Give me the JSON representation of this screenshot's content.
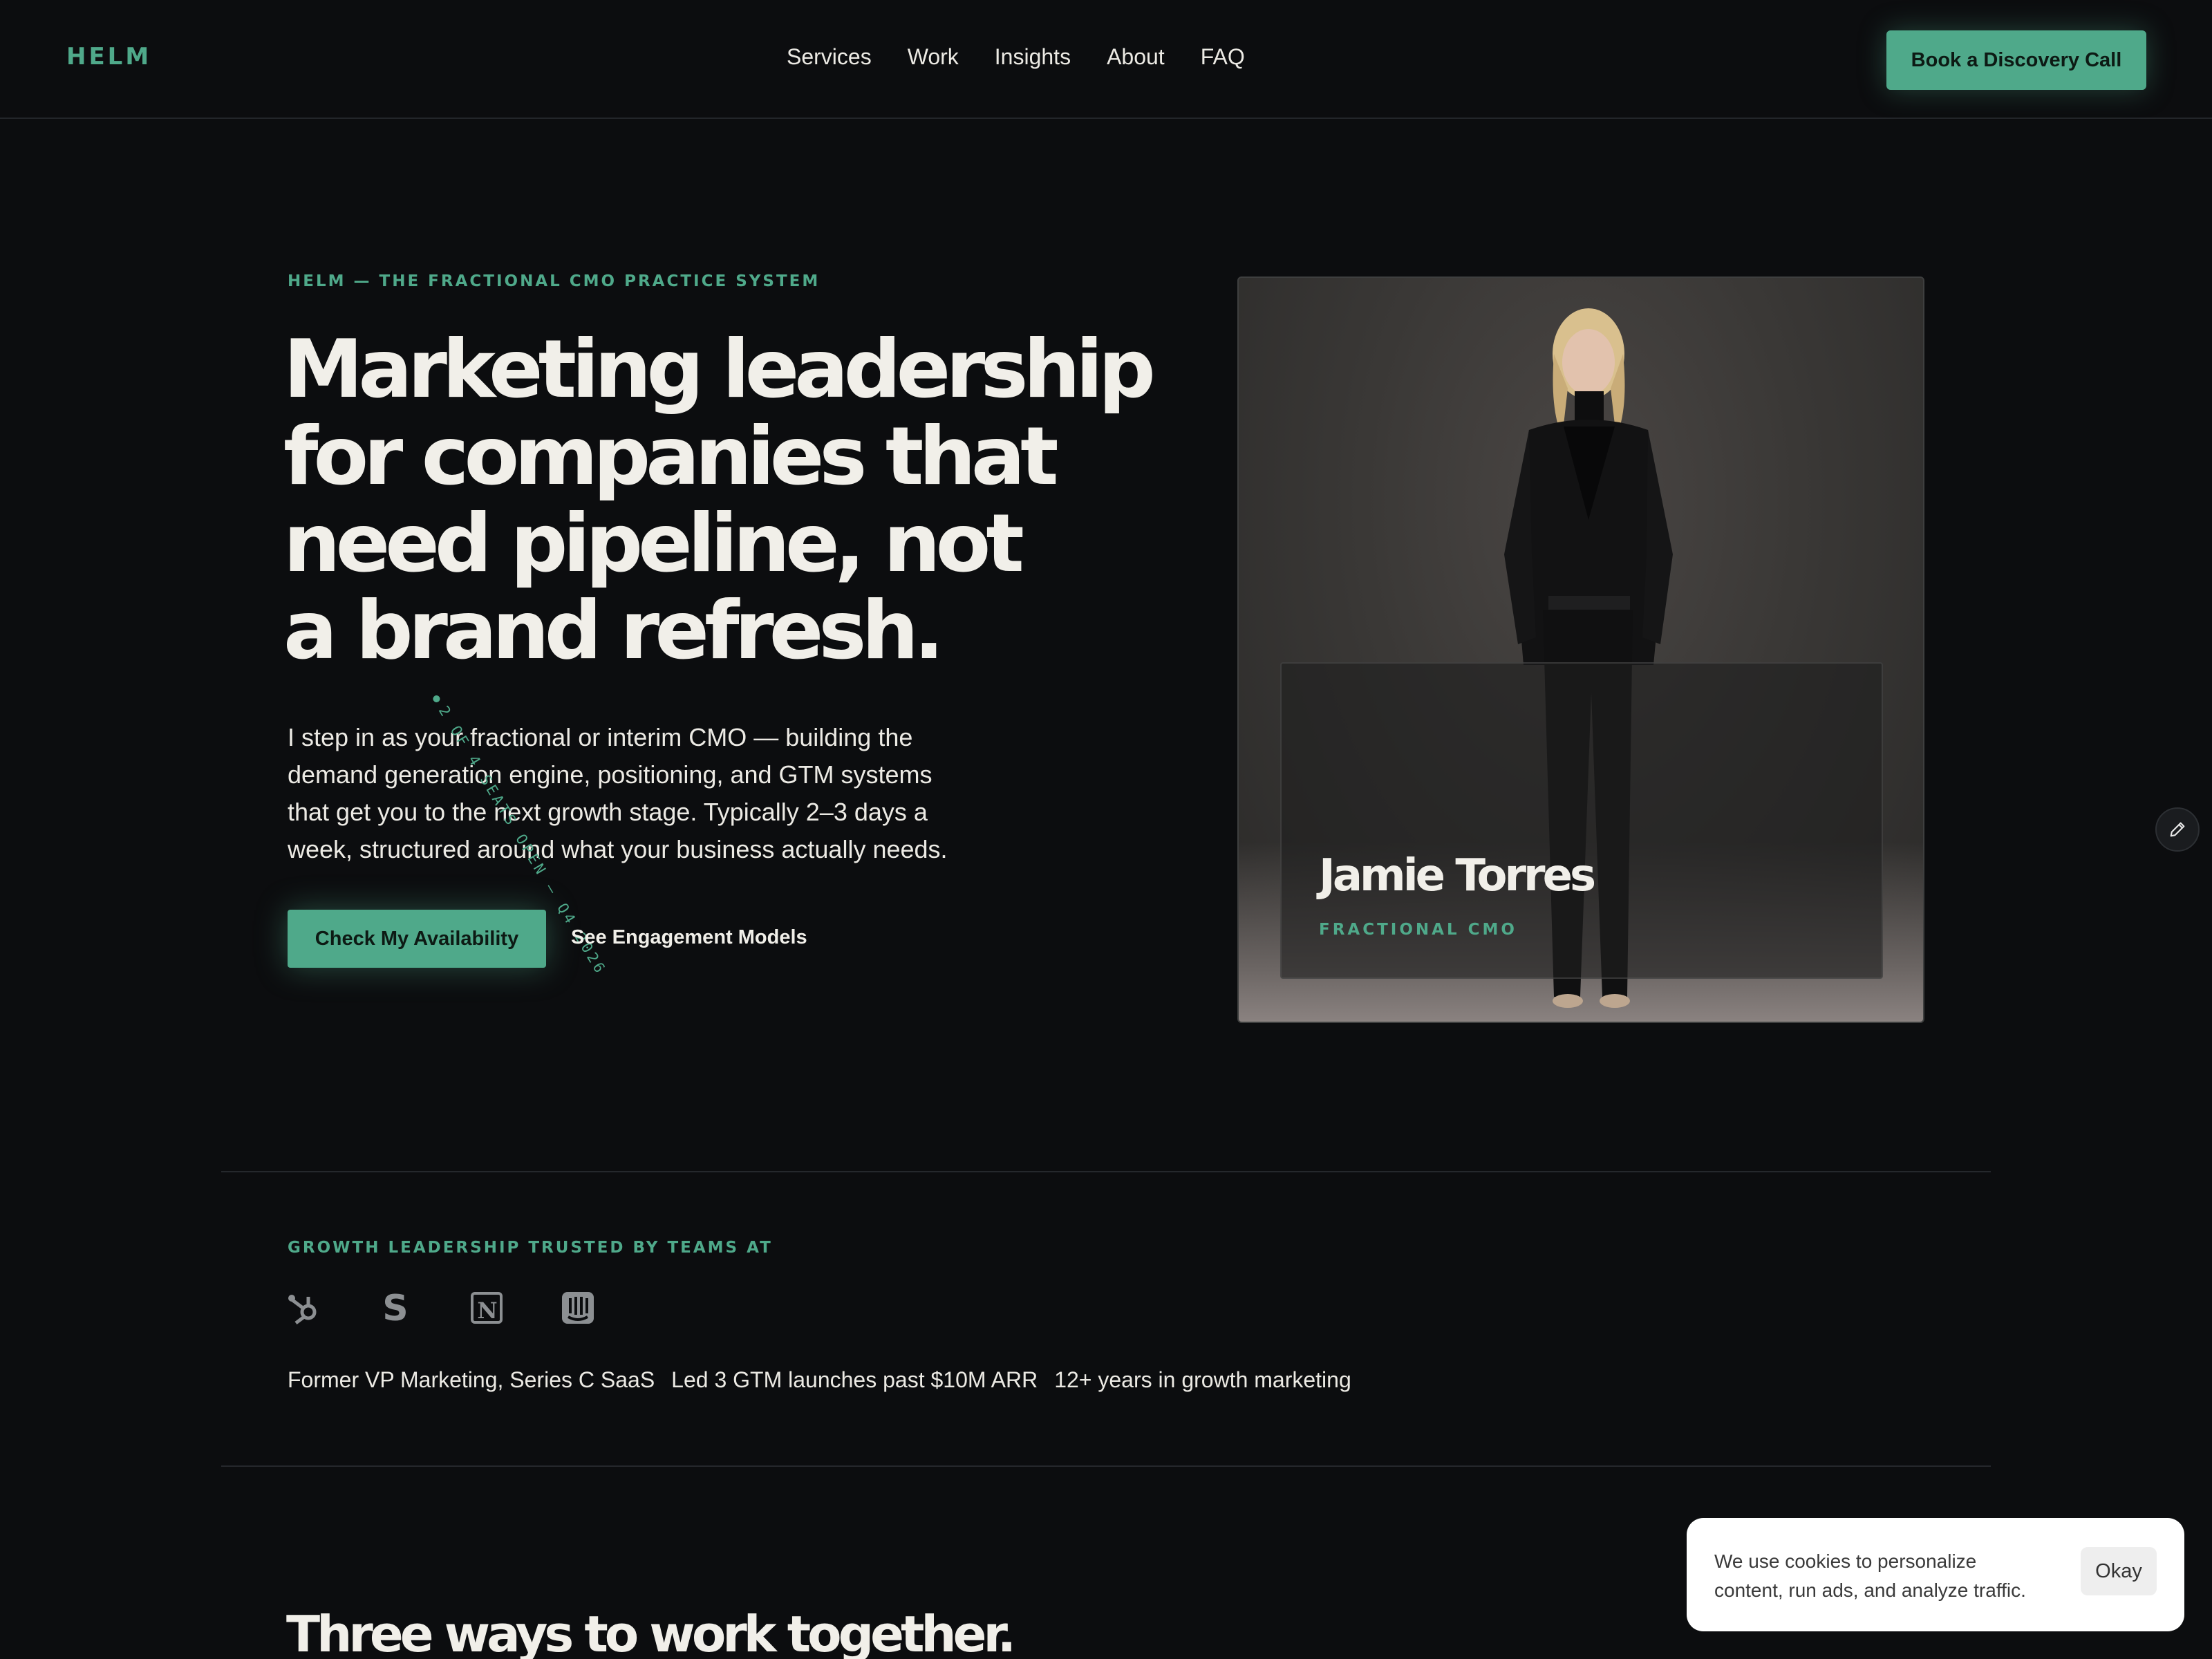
{
  "nav": {
    "logo": "HELM",
    "links": [
      "Services",
      "Work",
      "Insights",
      "About",
      "FAQ"
    ],
    "cta": "Book a Discovery Call"
  },
  "hero": {
    "eyebrow": "HELM — THE FRACTIONAL CMO PRACTICE SYSTEM",
    "title_lines": [
      "Marketing leadership",
      "for companies that",
      "need pipeline, not",
      "a brand refresh."
    ],
    "body_lines": [
      "I step in as your fractional or interim CMO — building the",
      "demand generation engine, positioning, and GTM systems",
      "that get you to the next growth stage. Typically 2–3 days a",
      "week, structured around what your business actually needs."
    ],
    "rotated_tag": "2 OF 4 SEATS OPEN — Q4 2026",
    "primary_button": "Check My Availability",
    "secondary_link": "See Engagement Models"
  },
  "profile": {
    "name": "Jamie Torres",
    "role": "FRACTIONAL CMO"
  },
  "trust": {
    "label": "GROWTH LEADERSHIP TRUSTED BY TEAMS AT",
    "logos": [
      "hubspot-logo-icon",
      "stripe-logo-icon",
      "notion-logo-icon",
      "intercom-logo-icon"
    ],
    "credentials": [
      "Former VP Marketing, Series C SaaS",
      "Led 3 GTM launches past $10M ARR",
      "12+ years in growth marketing"
    ]
  },
  "next_section": {
    "title": "Three ways to work together."
  },
  "cookie": {
    "message_lines": [
      "We use cookies to personalize",
      "content, run ads, and analyze traffic."
    ],
    "button": "Okay"
  },
  "colors": {
    "background": "#0c0d0f",
    "accent": "#4fa98a",
    "text": "#eceae4"
  }
}
